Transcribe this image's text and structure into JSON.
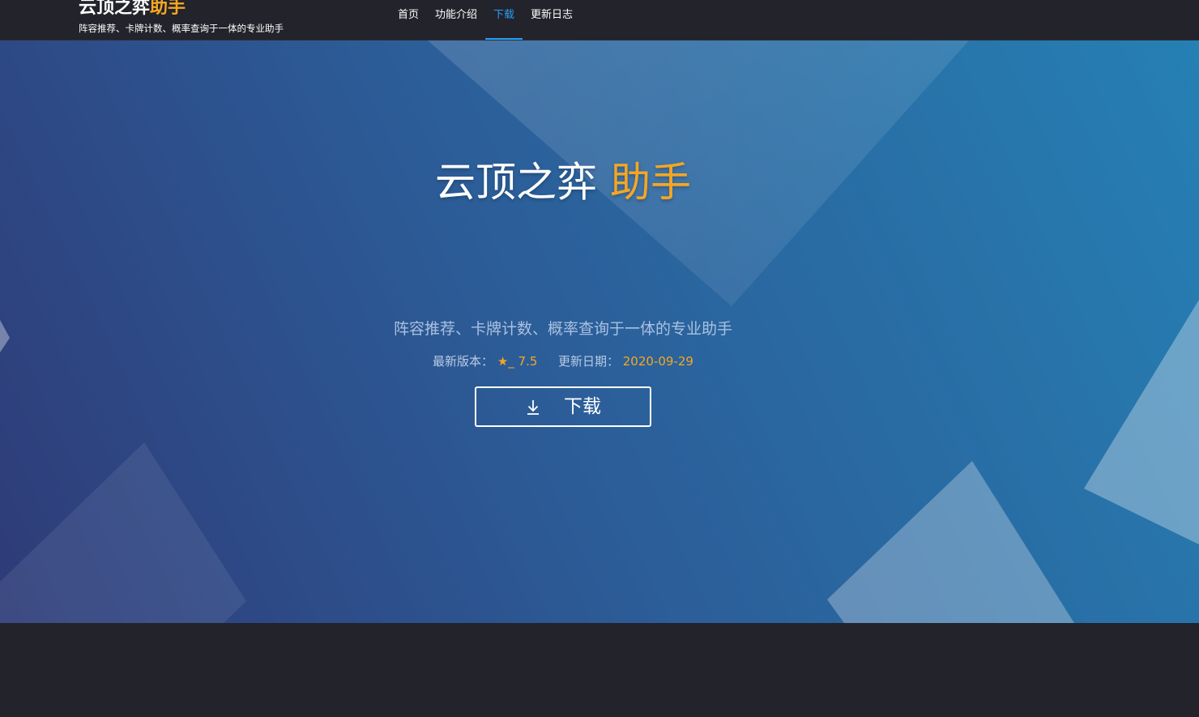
{
  "header": {
    "logo_white": "云顶之弈",
    "logo_accent": "助手",
    "subtitle": "阵容推荐、卡牌计数、概率查询于一体的专业助手",
    "nav": [
      {
        "label": "首页",
        "active": false
      },
      {
        "label": "功能介绍",
        "active": false
      },
      {
        "label": "下载",
        "active": true
      },
      {
        "label": "更新日志",
        "active": false
      }
    ]
  },
  "hero": {
    "title_white": "云顶之弈",
    "title_accent": "助手",
    "subtitle": "阵容推荐、卡牌计数、概率查询于一体的专业助手",
    "version_label": "最新版本：",
    "version_value": "★_ 7.5",
    "date_label": "更新日期：",
    "date_value": "2020-09-29",
    "download_label": "下载",
    "download_icon": "download-arrow-icon"
  },
  "colors": {
    "accent": "#f5a623",
    "nav_active": "#2a9df4",
    "background_dark": "#22232b",
    "hero_gradient_start": "#2e3b78",
    "hero_gradient_end": "#2580b4"
  }
}
